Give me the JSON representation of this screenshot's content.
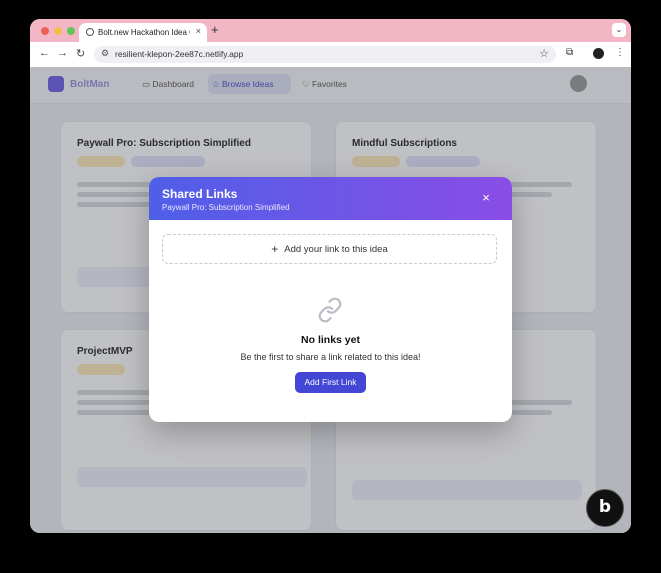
{
  "browser": {
    "tab_title": "Bolt.new Hackathon Idea Gen",
    "tab_close": "×",
    "new_tab": "+",
    "url": "resilient-klepon-2ee87c.netlify.app",
    "back": "←",
    "forward": "→",
    "reload": "↻",
    "star": "☆",
    "tab_menu": "⌄",
    "menu": "⋮",
    "extensions": "⧉"
  },
  "modal": {
    "title": "Shared Links",
    "subtitle": "Paywall Pro: Subscription Simplified",
    "close": "×",
    "add_link_plus": "+",
    "add_link_label": "Add your link to this idea",
    "empty_title": "No links yet",
    "empty_description": "Be the first to share a link related to this idea!",
    "add_first_button": "Add First Link"
  },
  "background": {
    "card_titles": [
      "Paywall Pro: Subscription Simplified",
      "Mindful Subscriptions",
      "ProjectMVP"
    ]
  },
  "badge": {
    "label": "b"
  },
  "colors": {
    "accent": "#4446d6",
    "gradient_start": "#4f5fe8",
    "gradient_end": "#8a4de6",
    "tab_strip": "#f3b6c4"
  }
}
